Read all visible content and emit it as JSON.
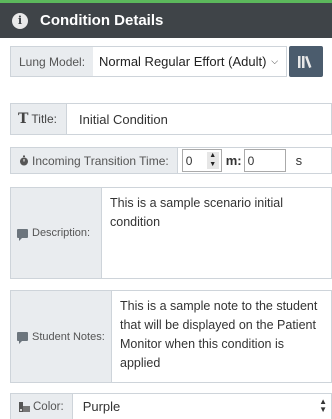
{
  "header": {
    "title": "Condition Details",
    "info_glyph": "i"
  },
  "lung_model": {
    "label": "Lung Model:",
    "value": "Normal Regular Effort (Adult)"
  },
  "title_field": {
    "label": "Title:",
    "value": "Initial Condition"
  },
  "transition": {
    "label": "Incoming Transition Time:",
    "minutes": "0",
    "seconds": "0",
    "minutes_unit": "m:",
    "seconds_unit": "s"
  },
  "description": {
    "label": "Description:",
    "value": "This is a sample scenario initial condition"
  },
  "notes": {
    "label": "Student Notes:",
    "value": "This is a sample note to the student that will be displayed on the Patient Monitor when this condition is applied"
  },
  "color": {
    "label": "Color:",
    "value": "Purple"
  },
  "theme": {
    "header_bg": "#3f4448",
    "accent_green": "#5cb85c",
    "library_button_bg": "#4b5c6d"
  }
}
